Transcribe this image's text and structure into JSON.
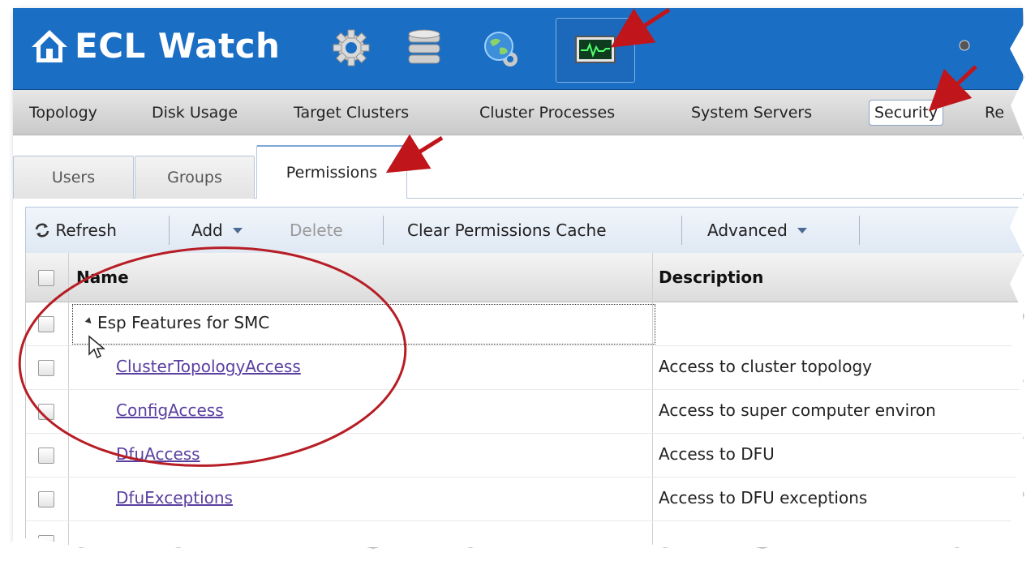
{
  "app": {
    "title": "ECL Watch"
  },
  "header_icons": [
    "gear-icon",
    "database-icon",
    "globe-icon",
    "monitor-icon"
  ],
  "nav": {
    "items": [
      "Topology",
      "Disk Usage",
      "Target Clusters",
      "Cluster Processes",
      "System Servers",
      "Security",
      "Re"
    ],
    "active": "Security"
  },
  "tabs": [
    {
      "label": "Users"
    },
    {
      "label": "Groups"
    },
    {
      "label": "Permissions"
    }
  ],
  "toolbar": {
    "refresh": "Refresh",
    "add": "Add",
    "delete": "Delete",
    "clear_cache": "Clear Permissions Cache",
    "advanced": "Advanced"
  },
  "grid": {
    "columns": [
      "Name",
      "Description"
    ],
    "group": "Esp Features for SMC",
    "rows": [
      {
        "name": "ClusterTopologyAccess",
        "description": "Access to cluster topology"
      },
      {
        "name": "ConfigAccess",
        "description": "Access to super computer environ"
      },
      {
        "name": "DfuAccess",
        "description": "Access to DFU"
      },
      {
        "name": "DfuExceptions",
        "description": "Access to DFU exceptions"
      }
    ]
  },
  "colors": {
    "header": "#1a6ec4",
    "annotation": "#c0161b",
    "link": "#5a3fa0"
  }
}
